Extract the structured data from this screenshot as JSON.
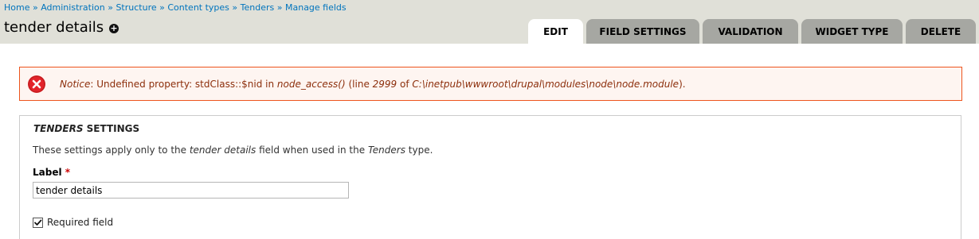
{
  "breadcrumb": {
    "items": [
      "Home",
      "Administration",
      "Structure",
      "Content types",
      "Tenders",
      "Manage fields"
    ],
    "separator": "»"
  },
  "page": {
    "title": "tender details",
    "shortcut_icon": "plus-circle-icon"
  },
  "tabs": [
    {
      "label": "EDIT",
      "active": true
    },
    {
      "label": "FIELD SETTINGS",
      "active": false
    },
    {
      "label": "VALIDATION",
      "active": false
    },
    {
      "label": "WIDGET TYPE",
      "active": false
    },
    {
      "label": "DELETE",
      "active": false
    }
  ],
  "message": {
    "icon": "error-icon",
    "type_label": "Notice",
    "text_1": ": Undefined property: stdClass::$nid in ",
    "function": "node_access()",
    "text_2": " (line ",
    "line": "2999",
    "text_3": " of ",
    "path": "C:\\inetpub\\wwwroot\\drupal\\modules\\node\\node.module",
    "text_4": ")."
  },
  "settings": {
    "legend_type": "TENDERS",
    "legend_rest": " SETTINGS",
    "desc_1": "These settings apply only to the ",
    "desc_field": "tender details",
    "desc_2": " field when used in the ",
    "desc_type": "Tenders",
    "desc_3": " type.",
    "label": "Label",
    "required_mark": "*",
    "label_value": "tender details",
    "required_field_label": "Required field",
    "required_checked": true
  },
  "colors": {
    "header_bg": "#e0e0d8",
    "link": "#0074bd",
    "tab_inactive": "#a6a7a2",
    "error_border": "#ed541d",
    "error_bg": "#fef5f1",
    "error_text": "#8c2e0b"
  }
}
